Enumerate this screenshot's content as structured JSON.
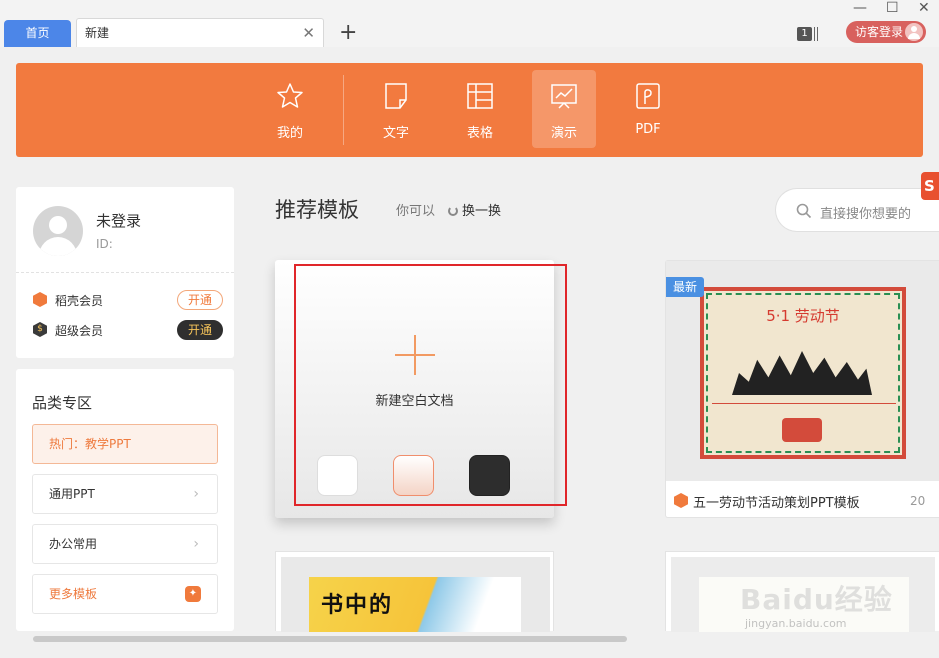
{
  "tabs": {
    "home": "首页",
    "new": "新建",
    "add_symbol": "+",
    "close_symbol": "✕"
  },
  "titlebar": {
    "badge_count": "1",
    "login_label": "访客登录",
    "window_controls": [
      "—",
      "☐",
      "✕"
    ]
  },
  "nav": {
    "items": [
      {
        "label": "我的",
        "icon": "star-icon"
      },
      {
        "label": "文字",
        "icon": "document-icon"
      },
      {
        "label": "表格",
        "icon": "table-icon"
      },
      {
        "label": "演示",
        "icon": "presentation-icon",
        "active": true
      },
      {
        "label": "PDF",
        "icon": "pdf-icon"
      }
    ]
  },
  "profile": {
    "name": "未登录",
    "id_label": "ID:",
    "memberships": [
      {
        "label": "稻壳会员",
        "button": "开通"
      },
      {
        "label": "超级会员",
        "button": "开通"
      }
    ]
  },
  "categories": {
    "title": "品类专区",
    "items": [
      {
        "label": "热门：教学PPT"
      },
      {
        "label": "通用PPT"
      },
      {
        "label": "办公常用"
      },
      {
        "label": "更多模板"
      }
    ]
  },
  "main": {
    "section_title": "推荐模板",
    "hint": "你可以",
    "refresh": "换一换",
    "search_placeholder": "直接搜你想要的"
  },
  "blank_card": {
    "label": "新建空白文档"
  },
  "template_card": {
    "badge": "最新",
    "poster_title": "5·1  劳动节",
    "title": "五一劳动节活动策划PPT模板",
    "year_partial": "20"
  },
  "bottom_cards": {
    "left_art_text": "书中的"
  },
  "watermark": {
    "main": "Baidu经验",
    "sub": "jingyan.baidu.com"
  },
  "colors": {
    "accent_orange": "#f27a3f",
    "tab_blue": "#4c86e8",
    "highlight_red": "#e0262a"
  }
}
